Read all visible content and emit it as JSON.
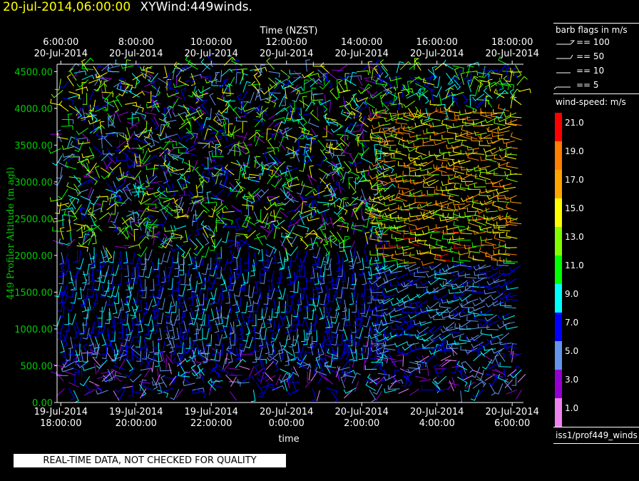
{
  "header": {
    "datetime": "20-jul-2014,06:00:00",
    "product": "XYWind:449winds."
  },
  "legend": {
    "barb_title": "barb flags in m/s",
    "barb_flags": [
      "== 100",
      "== 50",
      "== 10",
      "== 5"
    ],
    "speed_title": "wind-speed: m/s",
    "speed_scale": [
      {
        "label": "21.0",
        "color": "#ff0000"
      },
      {
        "label": "19.0",
        "color": "#ff7f00"
      },
      {
        "label": "17.0",
        "color": "#ffa500"
      },
      {
        "label": "15.0",
        "color": "#ffff00"
      },
      {
        "label": "13.0",
        "color": "#7fff00"
      },
      {
        "label": "11.0",
        "color": "#00ff00"
      },
      {
        "label": "9.0",
        "color": "#00ffff"
      },
      {
        "label": "7.0",
        "color": "#0000ff"
      },
      {
        "label": "5.0",
        "color": "#6495ed"
      },
      {
        "label": "3.0",
        "color": "#9400d3"
      },
      {
        "label": "1.0",
        "color": "#ee82ee"
      }
    ],
    "source": "iss1/prof449_winds"
  },
  "disclaimer": "REAL-TIME DATA, NOT CHECKED FOR QUALITY",
  "colors": {
    "plot_bg": "#000000",
    "axis": "#ffffff",
    "y_axis_text": "#00cc00",
    "title": "#ffff00"
  },
  "chart_data": {
    "type": "wind-barb time-height",
    "title": "Time (NZST)",
    "xlabel": "time",
    "ylabel": "449 Profiler Altitude (m agl)",
    "top_ticks": [
      {
        "time": "6:00:00",
        "date": "20-Jul-2014"
      },
      {
        "time": "8:00:00",
        "date": "20-Jul-2014"
      },
      {
        "time": "10:00:00",
        "date": "20-Jul-2014"
      },
      {
        "time": "12:00:00",
        "date": "20-Jul-2014"
      },
      {
        "time": "14:00:00",
        "date": "20-Jul-2014"
      },
      {
        "time": "16:00:00",
        "date": "20-Jul-2014"
      },
      {
        "time": "18:00:00",
        "date": "20-Jul-2014"
      }
    ],
    "bottom_ticks": [
      {
        "date": "19-Jul-2014",
        "time": "18:00:00"
      },
      {
        "date": "19-Jul-2014",
        "time": "20:00:00"
      },
      {
        "date": "19-Jul-2014",
        "time": "22:00:00"
      },
      {
        "date": "20-Jul-2014",
        "time": "0:00:00"
      },
      {
        "date": "20-Jul-2014",
        "time": "2:00:00"
      },
      {
        "date": "20-Jul-2014",
        "time": "4:00:00"
      },
      {
        "date": "20-Jul-2014",
        "time": "6:00:00"
      }
    ],
    "y_ticks": [
      "0.00",
      "500.00",
      "1000.00",
      "1500.00",
      "2000.00",
      "2500.00",
      "3000.00",
      "3500.00",
      "4000.00",
      "4500.00"
    ],
    "ylim": [
      0,
      4600
    ],
    "xlim_hours": [
      -0.1,
      12.3
    ],
    "speed_regimes": [
      {
        "t0": 0,
        "t1": 12.3,
        "z0": 150,
        "z1": 700,
        "speed": [
          1,
          9
        ],
        "dir": [
          0,
          360
        ]
      },
      {
        "t0": 0,
        "t1": 8.5,
        "z0": 700,
        "z1": 2100,
        "speed": [
          5,
          9
        ],
        "dir": [
          160,
          200
        ]
      },
      {
        "t0": 8.5,
        "t1": 12.3,
        "z0": 700,
        "z1": 1900,
        "speed": [
          4,
          9
        ],
        "dir": [
          230,
          280
        ]
      },
      {
        "t0": 8.5,
        "t1": 12.3,
        "z0": 1900,
        "z1": 2500,
        "speed": [
          10,
          21
        ],
        "dir": [
          250,
          290
        ]
      },
      {
        "t0": 0,
        "t1": 8.5,
        "z0": 2100,
        "z1": 4600,
        "speed": [
          2,
          16
        ],
        "dir": [
          0,
          360
        ]
      },
      {
        "t0": 8.5,
        "t1": 12.3,
        "z0": 2500,
        "z1": 4000,
        "speed": [
          12,
          20
        ],
        "dir": [
          240,
          290
        ]
      },
      {
        "t0": 8.5,
        "t1": 12.3,
        "z0": 4000,
        "z1": 4600,
        "speed": [
          6,
          15
        ],
        "dir": [
          0,
          360
        ]
      }
    ]
  }
}
